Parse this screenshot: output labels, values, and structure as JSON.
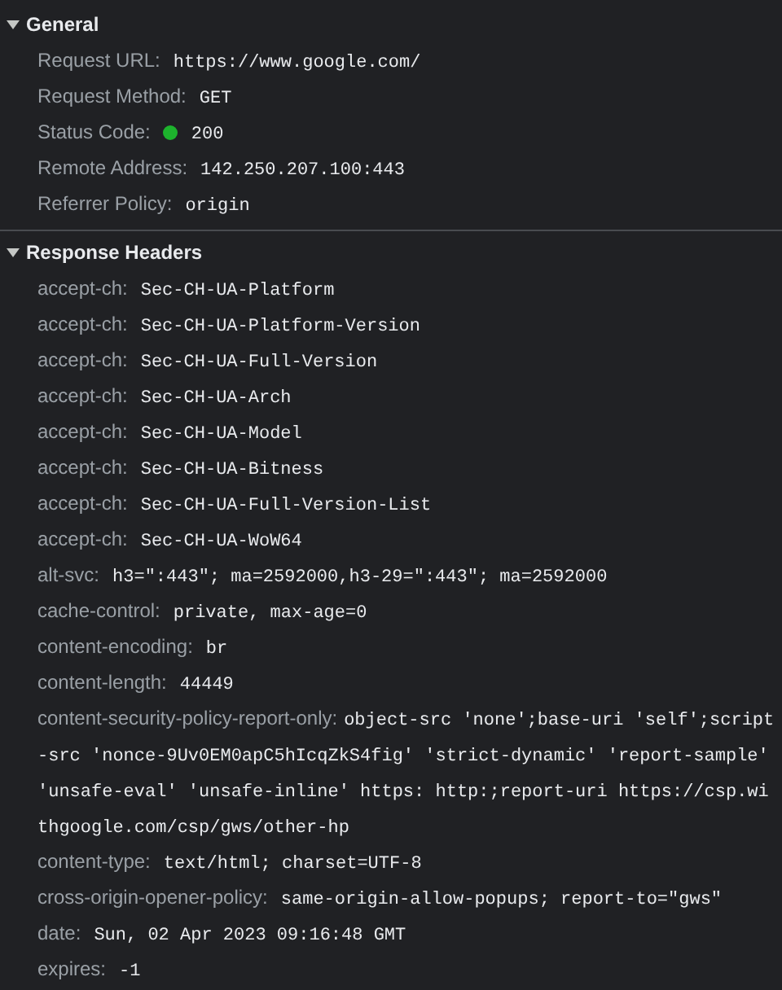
{
  "sections": [
    {
      "title": "General",
      "expanded": true,
      "rows": [
        {
          "name": "Request URL:",
          "value": "https://www.google.com/"
        },
        {
          "name": "Request Method:",
          "value": "GET"
        },
        {
          "name": "Status Code:",
          "value": "200",
          "color": "#1db32d"
        },
        {
          "name": "Remote Address:",
          "value": "142.250.207.100:443"
        },
        {
          "name": "Referrer Policy:",
          "value": "origin"
        }
      ]
    },
    {
      "title": "Response Headers",
      "expanded": true,
      "rows": [
        {
          "name": "accept-ch:",
          "value": "Sec-CH-UA-Platform"
        },
        {
          "name": "accept-ch:",
          "value": "Sec-CH-UA-Platform-Version"
        },
        {
          "name": "accept-ch:",
          "value": "Sec-CH-UA-Full-Version"
        },
        {
          "name": "accept-ch:",
          "value": "Sec-CH-UA-Arch"
        },
        {
          "name": "accept-ch:",
          "value": "Sec-CH-UA-Model"
        },
        {
          "name": "accept-ch:",
          "value": "Sec-CH-UA-Bitness"
        },
        {
          "name": "accept-ch:",
          "value": "Sec-CH-UA-Full-Version-List"
        },
        {
          "name": "accept-ch:",
          "value": "Sec-CH-UA-WoW64"
        },
        {
          "name": "alt-svc:",
          "value": "h3=\":443\"; ma=2592000,h3-29=\":443\"; ma=2592000"
        },
        {
          "name": "cache-control:",
          "value": "private, max-age=0"
        },
        {
          "name": "content-encoding:",
          "value": "br"
        },
        {
          "name": "content-length:",
          "value": "44449"
        },
        {
          "name": "content-security-policy-report-only:",
          "value": "object-src 'none';base-uri 'self';script-src 'nonce-9Uv0EM0apC5hIcqZkS4fig' 'strict-dynamic' 'report-sample' 'unsafe-eval' 'unsafe-inline' https: http:;report-uri https://csp.withgoogle.com/csp/gws/other-hp"
        },
        {
          "name": "content-type:",
          "value": "text/html; charset=UTF-8"
        },
        {
          "name": "cross-origin-opener-policy:",
          "value": "same-origin-allow-popups; report-to=\"gws\""
        },
        {
          "name": "date:",
          "value": "Sun, 02 Apr 2023 09:16:48 GMT"
        },
        {
          "name": "expires:",
          "value": "-1"
        }
      ]
    }
  ]
}
